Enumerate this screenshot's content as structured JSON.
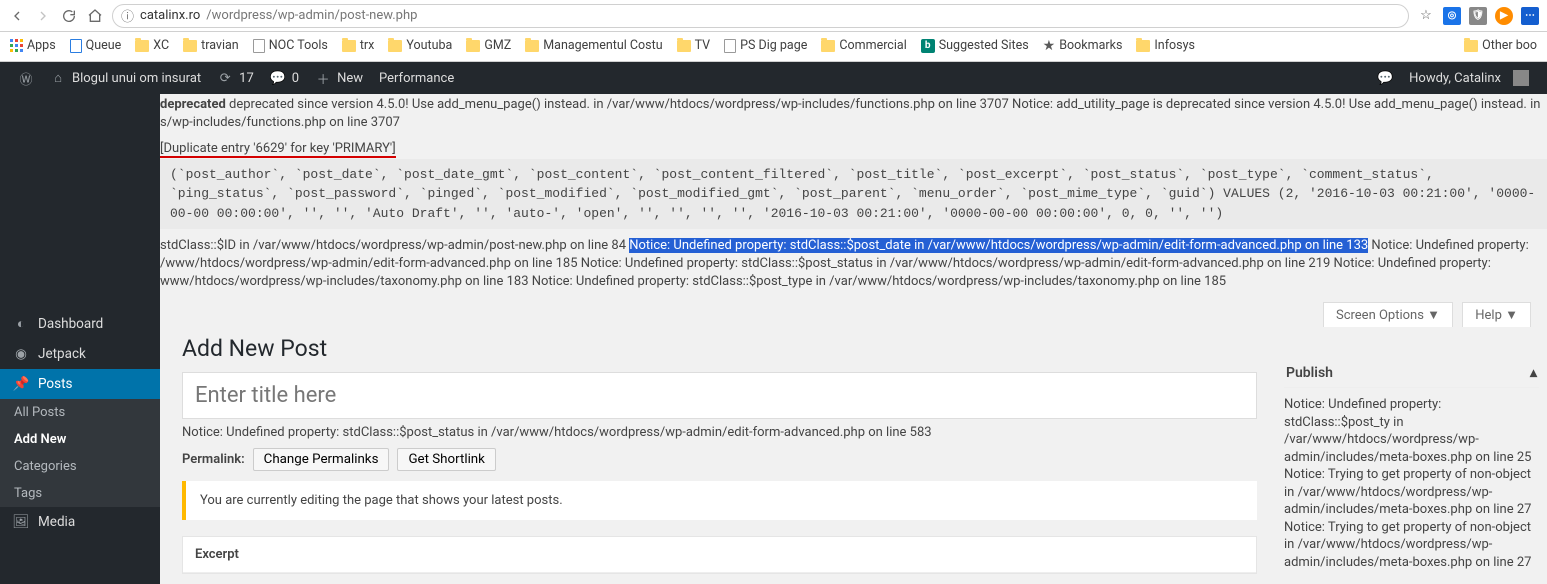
{
  "browser": {
    "url_scheme": "ⓘ",
    "url_host": "catalinx.ro",
    "url_path": "/wordpress/wp-admin/post-new.php",
    "bookmarks": [
      {
        "kind": "apps",
        "label": "Apps"
      },
      {
        "kind": "page",
        "label": "Queue"
      },
      {
        "kind": "folder",
        "label": "XC"
      },
      {
        "kind": "folder",
        "label": "travian"
      },
      {
        "kind": "page",
        "label": "NOC Tools"
      },
      {
        "kind": "folder",
        "label": "trx"
      },
      {
        "kind": "folder",
        "label": "Youtuba"
      },
      {
        "kind": "folder",
        "label": "GMZ"
      },
      {
        "kind": "folder",
        "label": "Managementul Costu"
      },
      {
        "kind": "folder",
        "label": "TV"
      },
      {
        "kind": "page",
        "label": "PS Dig page"
      },
      {
        "kind": "folder",
        "label": "Commercial"
      },
      {
        "kind": "bing",
        "label": "Suggested Sites"
      },
      {
        "kind": "star",
        "label": "Bookmarks"
      },
      {
        "kind": "folder",
        "label": "Infosys"
      }
    ],
    "other_bm": "Other boo"
  },
  "wpbar": {
    "site_name": "Blogul unui om insurat",
    "updates": "17",
    "comments": "0",
    "new": "New",
    "perf": "Performance",
    "howdy": "Howdy, Catalinx"
  },
  "sidebar": {
    "dashboard": "Dashboard",
    "jetpack": "Jetpack",
    "posts": "Posts",
    "all_posts": "All Posts",
    "add_new": "Add New",
    "categories": "Categories",
    "tags": "Tags",
    "media": "Media"
  },
  "errors": {
    "line1": "deprecated since version 4.5.0! Use add_menu_page() instead. in /var/www/htdocs/wordpress/wp-includes/functions.php on line 3707 Notice: add_utility_page is deprecated since version 4.5.0! Use add_menu_page() instead. in s/wp-includes/functions.php on line 3707",
    "dup": "[Duplicate entry '6629' for key 'PRIMARY']",
    "sql": " (`post_author`, `post_date`, `post_date_gmt`, `post_content`, `post_content_filtered`, `post_title`, `post_excerpt`, `post_status`, `post_type`, `comment_status`, `ping_status`, `post_password`, `pinged`, `post_modified`, `post_modified_gmt`, `post_parent`, `menu_order`, `post_mime_type`, `guid`) VALUES (2, '2016-10-03 00:21:00', '0000-00-00 00:00:00', '', '', 'Auto Draft', '', 'auto-', 'open', '', '', '', '', '2016-10-03 00:21:00', '0000-00-00 00:00:00', 0, 0, '', '')",
    "post1a": "stdClass::$ID in /var/www/htdocs/wordpress/wp-admin/post-new.php on line 84 ",
    "post1sel": "Notice: Undefined property: stdClass::$post_date in /var/www/htdocs/wordpress/wp-admin/edit-form-advanced.php on line 133",
    "post1b": " Notice: Undefined property: /www/htdocs/wordpress/wp-admin/edit-form-advanced.php on line 185 Notice: Undefined property: stdClass::$post_status in /var/www/htdocs/wordpress/wp-admin/edit-form-advanced.php on line 219 Notice: Undefined property: www/htdocs/wordpress/wp-includes/taxonomy.php on line 183 Notice: Undefined property: stdClass::$post_type in /var/www/htdocs/wordpress/wp-includes/taxonomy.php on line 185"
  },
  "screen": {
    "options": "Screen Options  ▼",
    "help": "Help  ▼"
  },
  "page": {
    "title_h1": "Add New Post",
    "title_placeholder": "Enter title here",
    "notice_under_title": "Notice: Undefined property: stdClass::$post_status in /var/www/htdocs/wordpress/wp-admin/edit-form-advanced.php on line 583",
    "permalink_label": "Permalink:",
    "change_perma": "Change Permalinks",
    "get_shortlink": "Get Shortlink",
    "editing_notice": "You are currently editing the page that shows your latest posts.",
    "excerpt": "Excerpt"
  },
  "publish": {
    "heading": "Publish",
    "notice": "Notice: Undefined property: stdClass::$post_ty in /var/www/htdocs/wordpress/wp-admin/includes/meta-boxes.php on line 25 Notice: Trying to get property of non-object in /var/www/htdocs/wordpress/wp-admin/includes/meta-boxes.php on line 27 Notice: Trying to get property of non-object in /var/www/htdocs/wordpress/wp-admin/includes/meta-boxes.php on line 27"
  }
}
